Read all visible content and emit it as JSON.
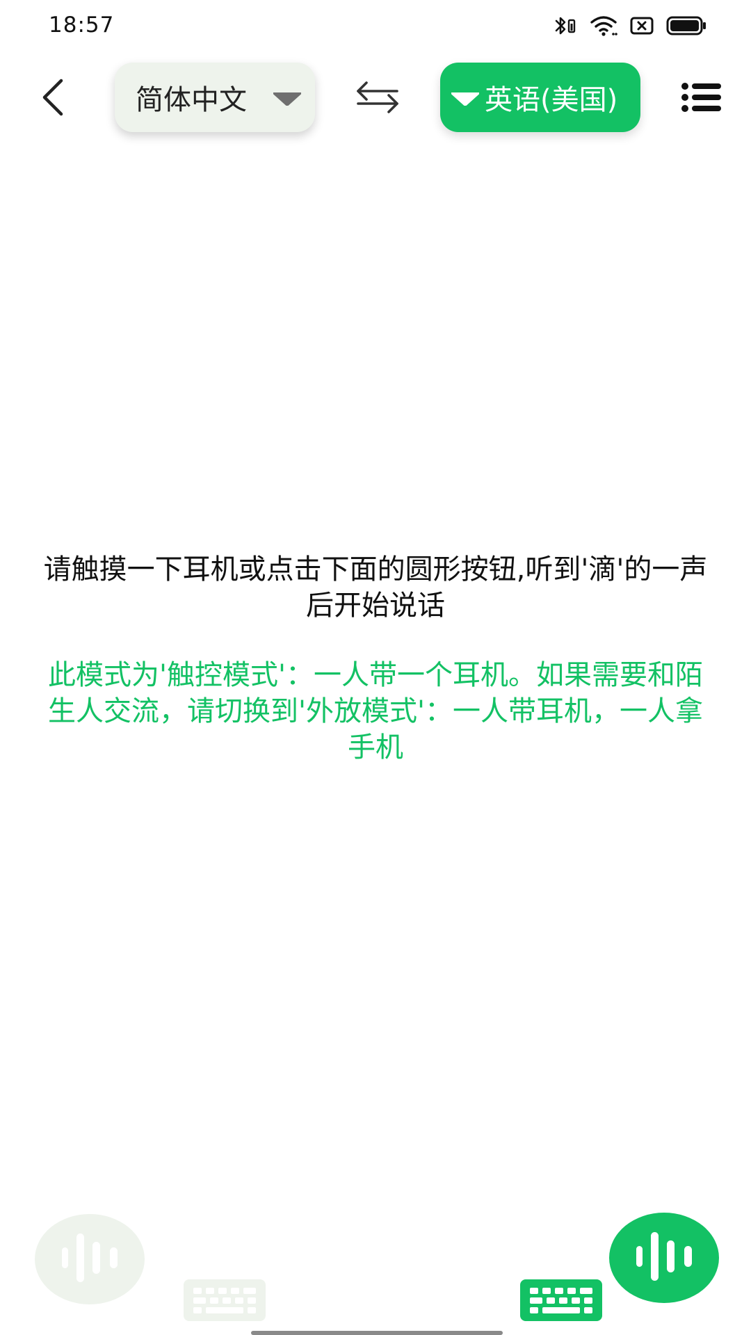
{
  "status_bar": {
    "time": "18:57",
    "icons": [
      "bluetooth-icon",
      "wifi-icon",
      "sim-disabled-icon",
      "battery-icon"
    ]
  },
  "toolbar": {
    "source_language": "简体中文",
    "target_language": "英语(美国)",
    "icons": [
      "back-arrow-icon",
      "caret-down-icon",
      "swap-arrows-icon",
      "list-menu-icon"
    ]
  },
  "messages": {
    "instruction": "请触摸一下耳机或点击下面的圆形按钮,听到'滴'的一声后开始说话",
    "mode_note": "此模式为'触控模式'：一人带一个耳机。如果需要和陌生人交流，请切换到'外放模式'：一人带耳机，一人拿手机"
  },
  "bottom": {
    "icons": [
      "voice-wave-icon",
      "keyboard-icon"
    ]
  },
  "colors": {
    "accent_green": "#13c164",
    "light_green": "#eef3ec",
    "text_dark": "#111111"
  }
}
